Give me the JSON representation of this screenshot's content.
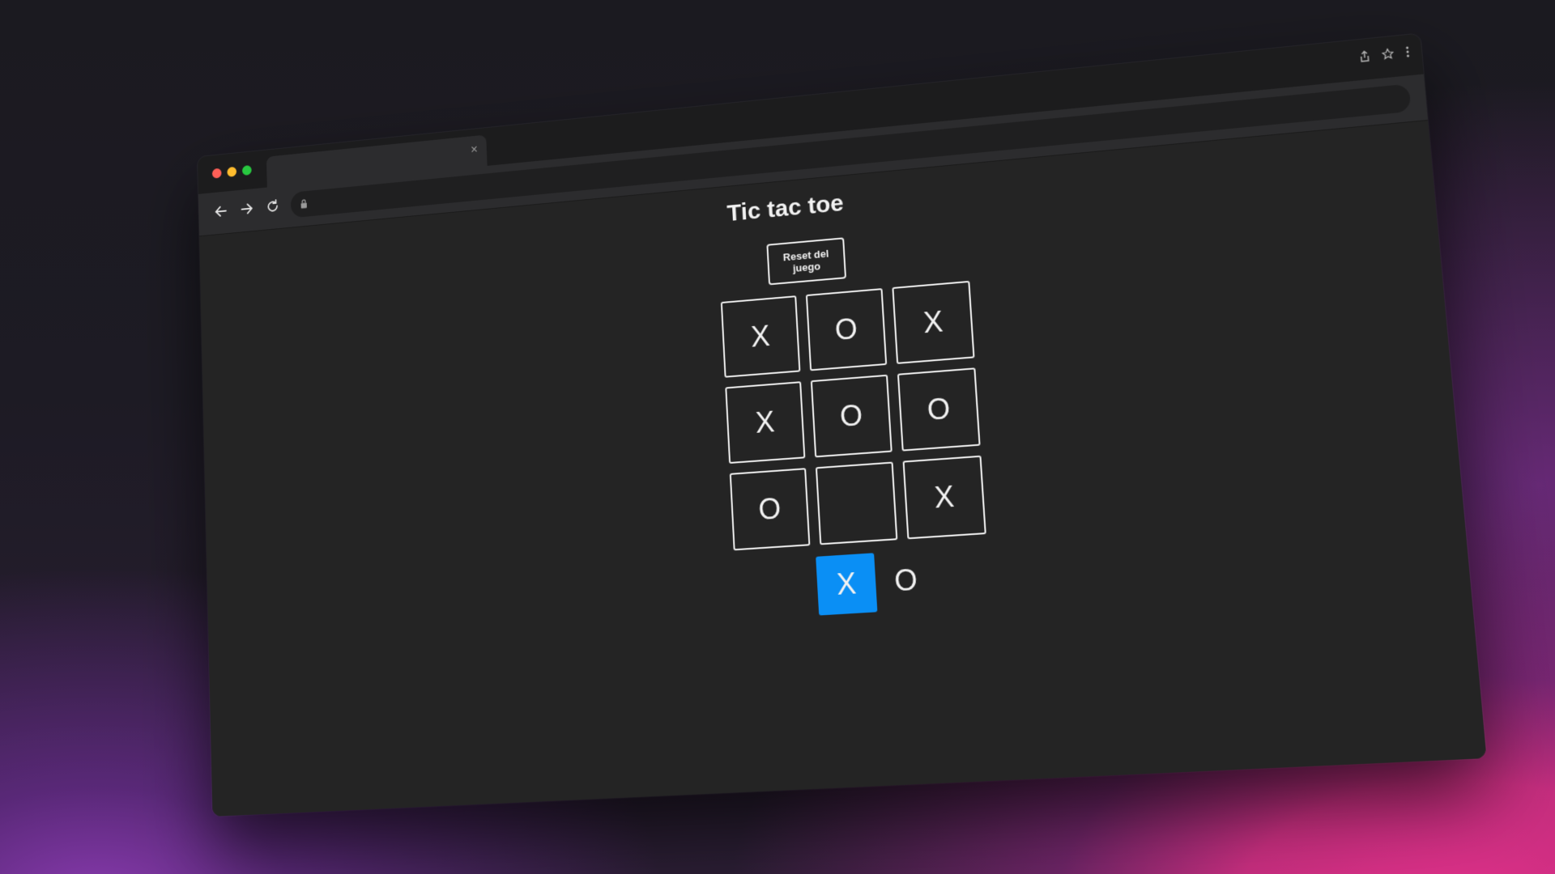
{
  "browser": {
    "tab": {
      "title": "",
      "close_glyph": "×"
    },
    "toolbar": {
      "back_icon": "arrow-left-icon",
      "forward_icon": "arrow-right-icon",
      "reload_icon": "reload-icon",
      "url": "",
      "lock_icon": "lock-icon"
    },
    "window_icons": [
      "share-icon",
      "star-icon",
      "more-vertical-icon"
    ]
  },
  "page": {
    "title": "Tic tac toe",
    "reset_label": "Reset del juego"
  },
  "board": {
    "cells": [
      "X",
      "O",
      "X",
      "X",
      "O",
      "O",
      "O",
      "",
      "X"
    ]
  },
  "turn": {
    "players": [
      "X",
      "O"
    ],
    "active": "X",
    "active_color": "#0a8ff5"
  },
  "colors": {
    "page_background": "#242424",
    "text": "#f2f2f2",
    "traffic_red": "#fe5f57",
    "traffic_yellow": "#febc2e",
    "traffic_green": "#28c840"
  }
}
